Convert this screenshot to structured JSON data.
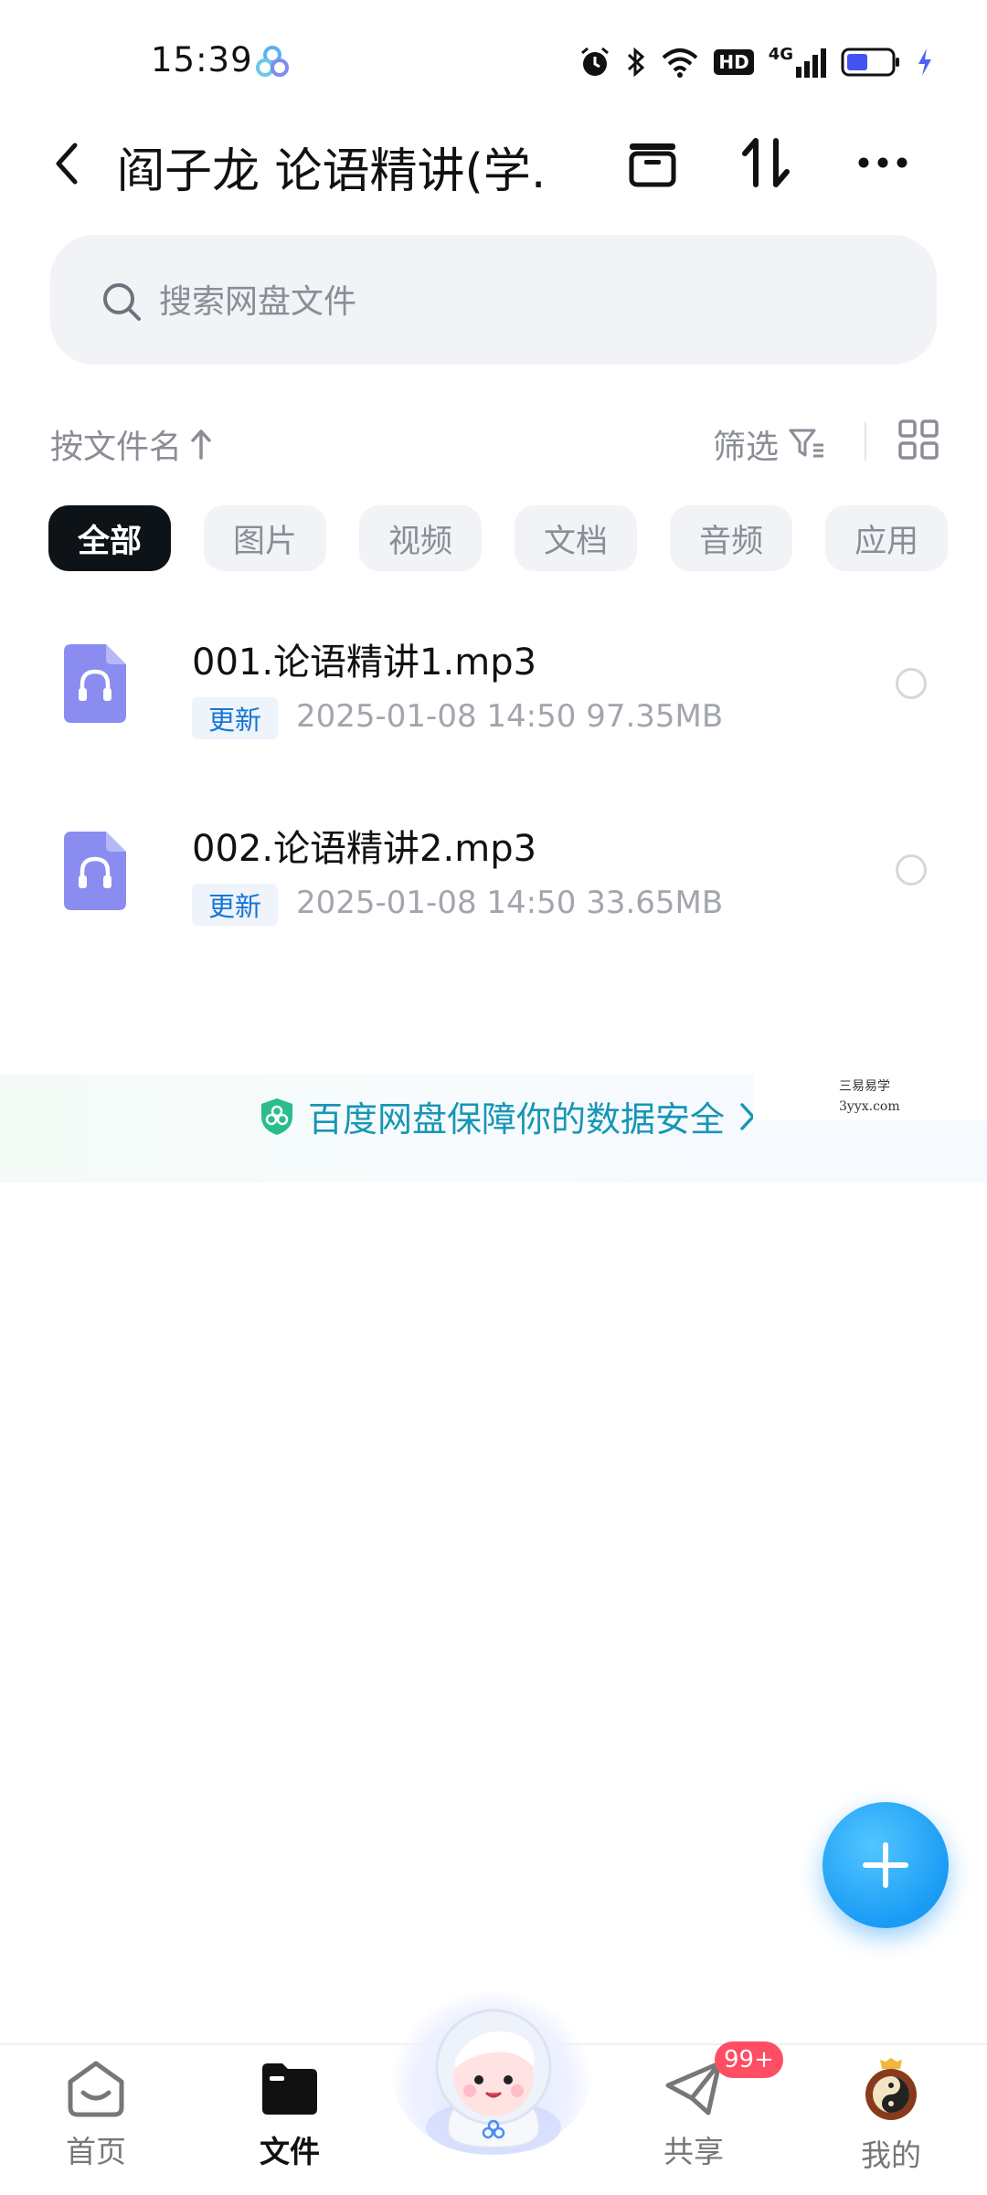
{
  "status_bar": {
    "time": "15:39",
    "icons": [
      "app-cloud-icon",
      "alarm-icon",
      "bluetooth-icon",
      "wifi-icon",
      "hd-icon",
      "signal-4g-icon",
      "battery-icon",
      "charging-icon"
    ],
    "hd_label": "HD",
    "network_label": "4G"
  },
  "nav": {
    "title": "阎子龙 论语精讲(学...",
    "icons": [
      "back-icon",
      "archive-icon",
      "transfer-icon",
      "more-icon"
    ]
  },
  "search": {
    "placeholder": "搜索网盘文件"
  },
  "sort": {
    "label": "按文件名",
    "filter_label": "筛选"
  },
  "categories": [
    {
      "label": "全部",
      "active": true
    },
    {
      "label": "图片",
      "active": false
    },
    {
      "label": "视频",
      "active": false
    },
    {
      "label": "文档",
      "active": false
    },
    {
      "label": "音频",
      "active": false
    },
    {
      "label": "应用",
      "active": false
    }
  ],
  "files": [
    {
      "name": "001.论语精讲1.mp3",
      "badge": "更新",
      "meta": "2025-01-08  14:50   97.35MB",
      "icon": "audio-file-icon"
    },
    {
      "name": "002.论语精讲2.mp3",
      "badge": "更新",
      "meta": "2025-01-08  14:50   33.65MB",
      "icon": "audio-file-icon"
    }
  ],
  "banner": {
    "text": "百度网盘保障你的数据安全",
    "watermark_line1": "三易易学",
    "watermark_line2": "3yyx.com"
  },
  "tabbar": {
    "items": [
      {
        "label": "首页",
        "active": false,
        "icon": "home-icon"
      },
      {
        "label": "文件",
        "active": true,
        "icon": "folder-icon"
      },
      {
        "label": "",
        "active": false,
        "icon": "mascot-icon"
      },
      {
        "label": "共享",
        "active": false,
        "icon": "share-icon"
      },
      {
        "label": "我的",
        "active": false,
        "icon": "avatar-icon"
      }
    ],
    "share_badge": "99+"
  },
  "colors": {
    "accent": "#1a9cf5",
    "active_chip": "#0e1318",
    "badge_red": "#ff4d63",
    "file_icon": "#8b8cf0"
  }
}
